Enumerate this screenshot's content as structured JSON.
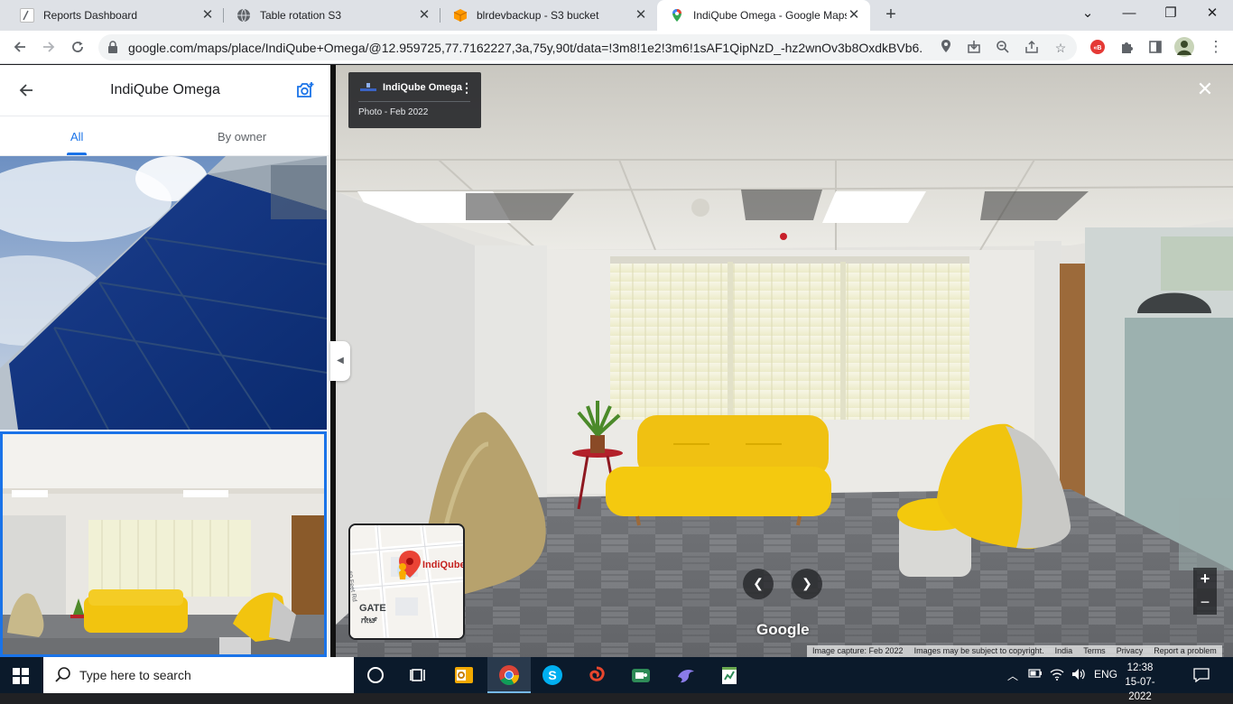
{
  "browser": {
    "tabs": [
      {
        "title": "Reports Dashboard",
        "icon": "reports-favicon",
        "color": "#e8eaed"
      },
      {
        "title": "Table rotation S3",
        "icon": "globe-favicon",
        "color": "#5f6368"
      },
      {
        "title": "blrdevbackup - S3 bucket",
        "icon": "aws-s3-favicon",
        "color": "#ff9900"
      },
      {
        "title": "IndiQube Omega - Google Maps",
        "icon": "maps-pin-favicon",
        "color": "#34a853"
      }
    ],
    "url": "google.com/maps/place/IndiQube+Omega/@12.959725,77.7162227,3a,75y,90t/data=!3m8!1e2!3m6!1sAF1QipNzD_-hz2wnOv3b8OxdkBVb6...",
    "window_controls": [
      "chevron-down-icon",
      "minimize-icon",
      "restore-icon",
      "close-icon"
    ]
  },
  "panel": {
    "title": "IndiQube Omega",
    "tabs": [
      "All",
      "By owner"
    ],
    "active_tab": "All"
  },
  "viewer": {
    "place_name": "IndiQube Omega",
    "photo_date": "Photo - Feb 2022",
    "watermark": "Google",
    "minimap": {
      "label": "IndiQube",
      "street": "60 Feet Rd",
      "gate": "GATE",
      "gate_local": "ಗೇಟ್"
    },
    "footer": [
      "Image capture: Feb 2022",
      "Images may be subject to copyright.",
      "India",
      "Terms",
      "Privacy",
      "Report a problem"
    ]
  },
  "taskbar": {
    "search_placeholder": "Type here to search",
    "apps": [
      "task-view-icon",
      "outlook-icon",
      "chrome-icon",
      "skype-icon",
      "swirl-app-icon",
      "green-app-icon",
      "dolphin-app-icon",
      "notepad-chart-icon"
    ],
    "language": "ENG",
    "time": "12:38",
    "date": "15-07-2022"
  },
  "colors": {
    "accent": "#1a73e8",
    "taskbar": "#0b1a2b",
    "sofa": "#f2c40f"
  }
}
